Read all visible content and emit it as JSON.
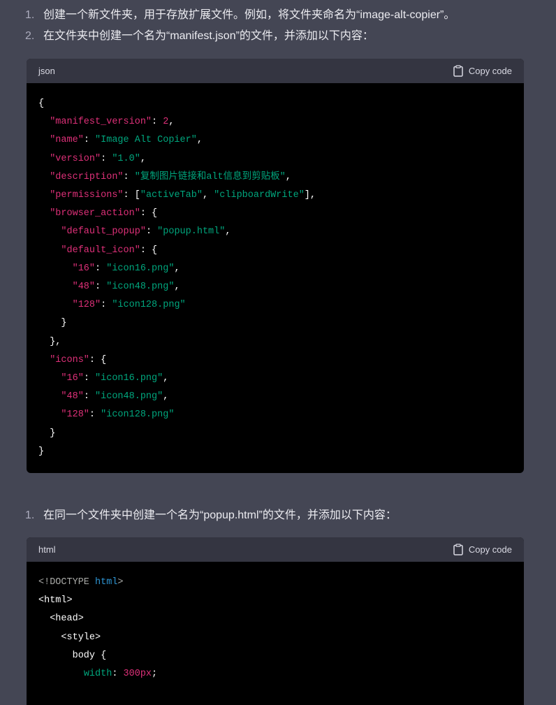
{
  "steps_top": [
    {
      "num": "1.",
      "text": "创建一个新文件夹，用于存放扩展文件。例如，将文件夹命名为“image-alt-copier”。"
    },
    {
      "num": "2.",
      "text": "在文件夹中创建一个名为“manifest.json”的文件，并添加以下内容："
    }
  ],
  "step_mid": {
    "num": "1.",
    "text": "在同一个文件夹中创建一个名为“popup.html”的文件，并添加以下内容："
  },
  "code_blocks": [
    {
      "language": "json",
      "copy_label": "Copy code",
      "lines": [
        [
          [
            "{",
            "p"
          ]
        ],
        [
          [
            "  ",
            ""
          ],
          [
            "\"manifest_version\"",
            "k"
          ],
          [
            ": ",
            "p"
          ],
          [
            "2",
            "n"
          ],
          [
            ",",
            "p"
          ]
        ],
        [
          [
            "  ",
            ""
          ],
          [
            "\"name\"",
            "k"
          ],
          [
            ": ",
            "p"
          ],
          [
            "\"Image Alt Copier\"",
            "s"
          ],
          [
            ",",
            "p"
          ]
        ],
        [
          [
            "  ",
            ""
          ],
          [
            "\"version\"",
            "k"
          ],
          [
            ": ",
            "p"
          ],
          [
            "\"1.0\"",
            "s"
          ],
          [
            ",",
            "p"
          ]
        ],
        [
          [
            "  ",
            ""
          ],
          [
            "\"description\"",
            "k"
          ],
          [
            ": ",
            "p"
          ],
          [
            "\"复制图片链接和alt信息到剪贴板\"",
            "s"
          ],
          [
            ",",
            "p"
          ]
        ],
        [
          [
            "  ",
            ""
          ],
          [
            "\"permissions\"",
            "k"
          ],
          [
            ": [",
            "p"
          ],
          [
            "\"activeTab\"",
            "s"
          ],
          [
            ", ",
            "p"
          ],
          [
            "\"clipboardWrite\"",
            "s"
          ],
          [
            "],",
            "p"
          ]
        ],
        [
          [
            "  ",
            ""
          ],
          [
            "\"browser_action\"",
            "k"
          ],
          [
            ": {",
            "p"
          ]
        ],
        [
          [
            "    ",
            ""
          ],
          [
            "\"default_popup\"",
            "k"
          ],
          [
            ": ",
            "p"
          ],
          [
            "\"popup.html\"",
            "s"
          ],
          [
            ",",
            "p"
          ]
        ],
        [
          [
            "    ",
            ""
          ],
          [
            "\"default_icon\"",
            "k"
          ],
          [
            ": {",
            "p"
          ]
        ],
        [
          [
            "      ",
            ""
          ],
          [
            "\"16\"",
            "k"
          ],
          [
            ": ",
            "p"
          ],
          [
            "\"icon16.png\"",
            "s"
          ],
          [
            ",",
            "p"
          ]
        ],
        [
          [
            "      ",
            ""
          ],
          [
            "\"48\"",
            "k"
          ],
          [
            ": ",
            "p"
          ],
          [
            "\"icon48.png\"",
            "s"
          ],
          [
            ",",
            "p"
          ]
        ],
        [
          [
            "      ",
            ""
          ],
          [
            "\"128\"",
            "k"
          ],
          [
            ": ",
            "p"
          ],
          [
            "\"icon128.png\"",
            "s"
          ]
        ],
        [
          [
            "    }",
            "p"
          ]
        ],
        [
          [
            "  },",
            "p"
          ]
        ],
        [
          [
            "  ",
            ""
          ],
          [
            "\"icons\"",
            "k"
          ],
          [
            ": {",
            "p"
          ]
        ],
        [
          [
            "    ",
            ""
          ],
          [
            "\"16\"",
            "k"
          ],
          [
            ": ",
            "p"
          ],
          [
            "\"icon16.png\"",
            "s"
          ],
          [
            ",",
            "p"
          ]
        ],
        [
          [
            "    ",
            ""
          ],
          [
            "\"48\"",
            "k"
          ],
          [
            ": ",
            "p"
          ],
          [
            "\"icon48.png\"",
            "s"
          ],
          [
            ",",
            "p"
          ]
        ],
        [
          [
            "    ",
            ""
          ],
          [
            "\"128\"",
            "k"
          ],
          [
            ": ",
            "p"
          ],
          [
            "\"icon128.png\"",
            "s"
          ]
        ],
        [
          [
            "  }",
            "p"
          ]
        ],
        [
          [
            "}",
            "p"
          ]
        ]
      ]
    },
    {
      "language": "html",
      "copy_label": "Copy code",
      "lines": [
        [
          [
            "<!DOCTYPE ",
            "g"
          ],
          [
            "html",
            "b"
          ],
          [
            ">",
            "g"
          ]
        ],
        [
          [
            "<html>",
            "p"
          ]
        ],
        [
          [
            "  <head>",
            "p"
          ]
        ],
        [
          [
            "    <style>",
            "p"
          ]
        ],
        [
          [
            "      body {",
            "p"
          ]
        ],
        [
          [
            "        ",
            ""
          ],
          [
            "width",
            "s"
          ],
          [
            ": ",
            "p"
          ],
          [
            "300px",
            "n"
          ],
          [
            ";",
            "p"
          ]
        ]
      ]
    }
  ],
  "colors": {
    "background": "#444654",
    "code_header": "#343541",
    "code_bg": "#000000",
    "key": "#df3079",
    "string": "#00a67d"
  }
}
